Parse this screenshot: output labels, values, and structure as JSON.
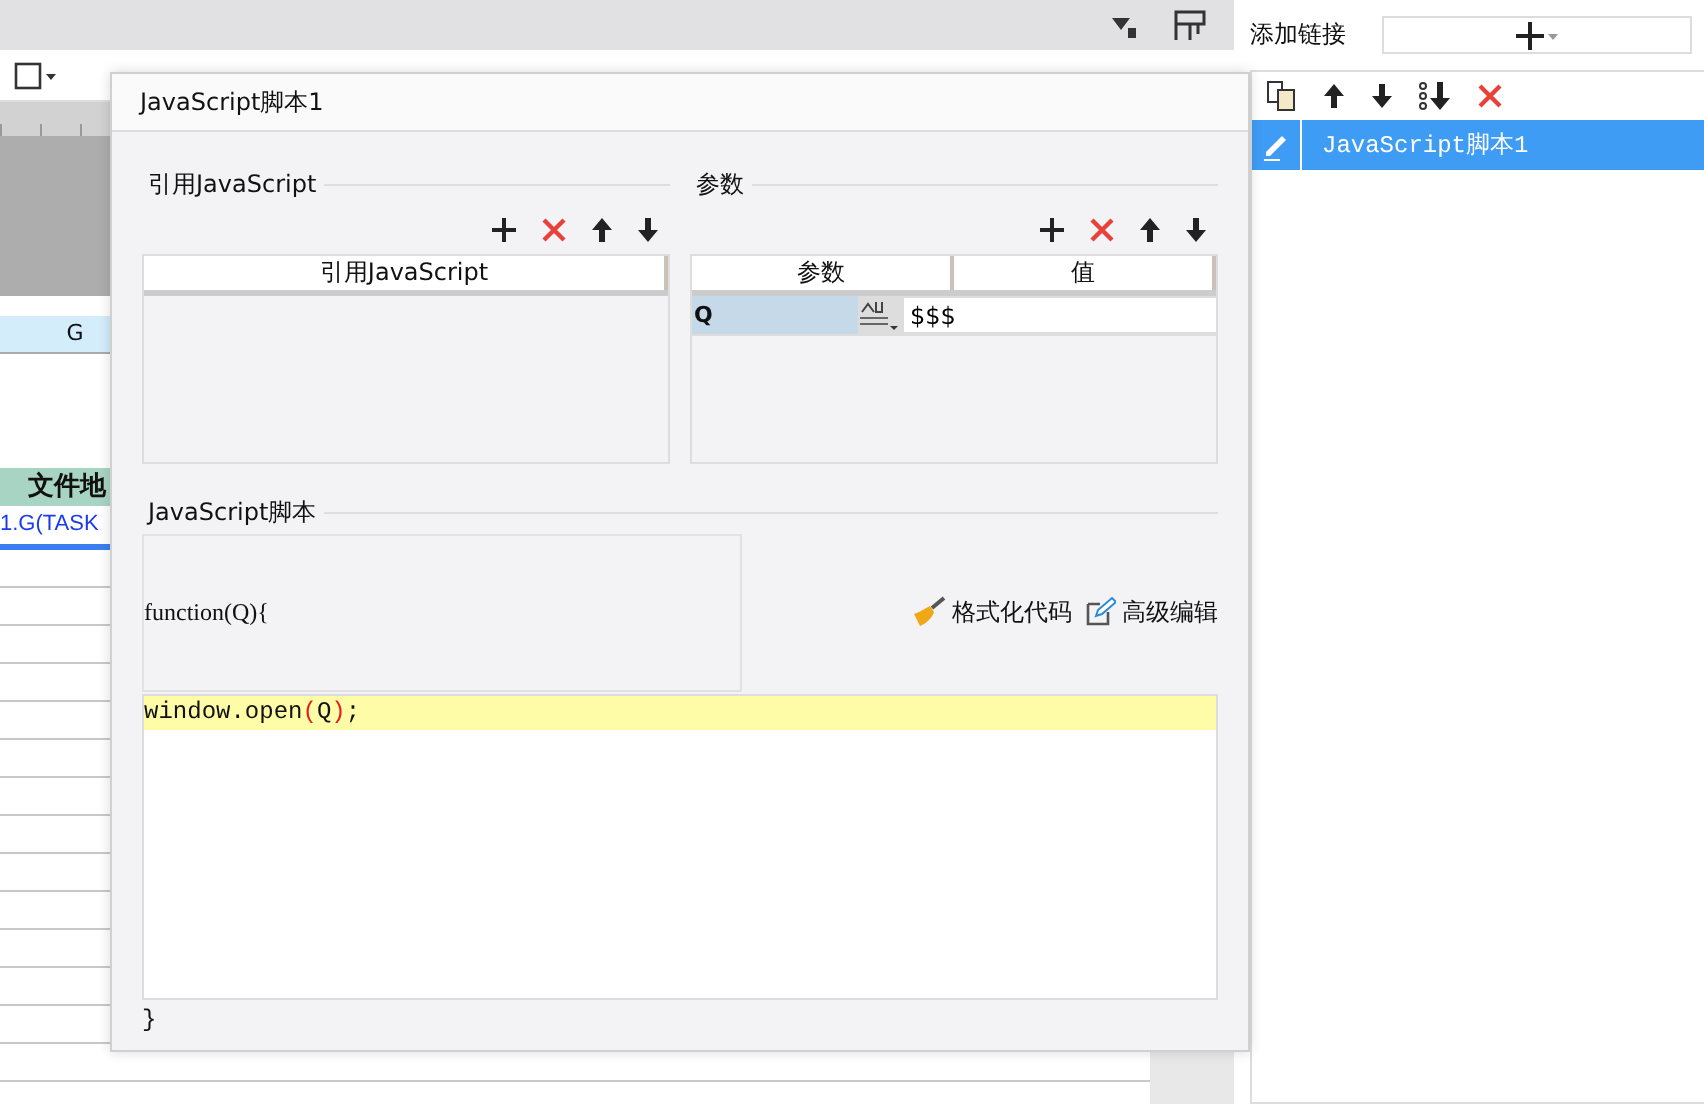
{
  "sheet": {
    "column_header": "G",
    "header_cell": "文件地",
    "link_cell": "1.G(TASK"
  },
  "dialog": {
    "title": "JavaScript脚本1",
    "imports": {
      "legend": "引用JavaScript",
      "columns": [
        "引用JavaScript"
      ]
    },
    "params": {
      "legend": "参数",
      "columns": [
        "参数",
        "值"
      ],
      "rows": [
        {
          "name": "Q",
          "value": "$$$",
          "selected": true
        }
      ]
    },
    "script": {
      "legend": "JavaScript脚本",
      "signature": "function(Q){",
      "actions": [
        {
          "label": "格式化代码",
          "kind": "format"
        },
        {
          "label": "高级编辑",
          "kind": "edit"
        }
      ],
      "lines": [
        {
          "text": "window.open(Q);",
          "highlighted": true
        }
      ],
      "closing": "}"
    }
  },
  "links_panel": {
    "label": "添加链接",
    "items": [
      {
        "label": "JavaScript脚本1",
        "selected": true
      }
    ]
  }
}
